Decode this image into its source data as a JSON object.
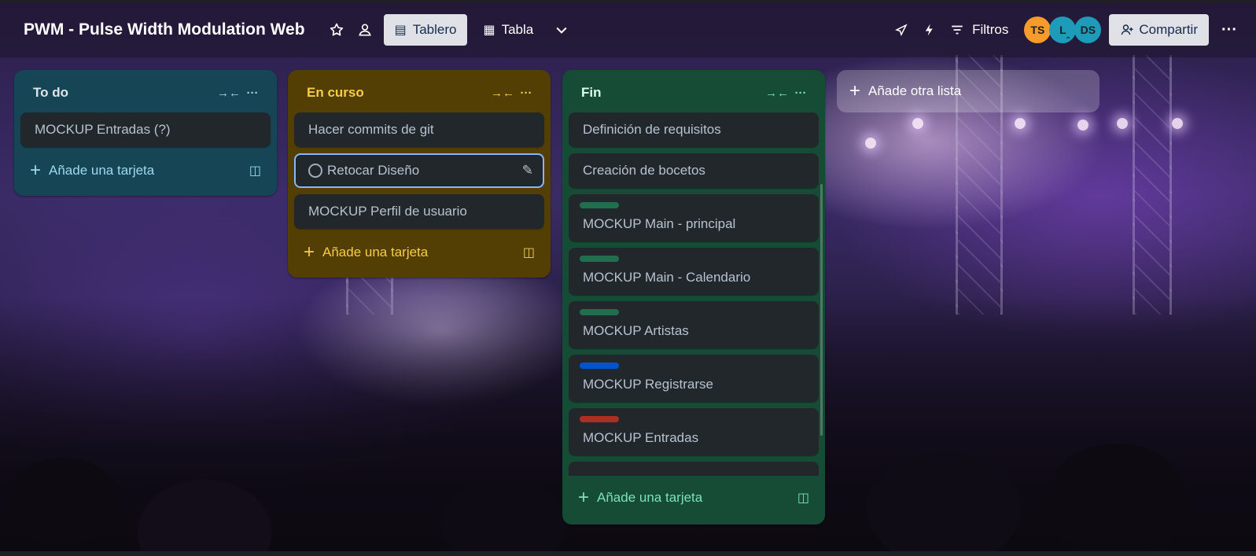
{
  "header": {
    "board_title": "PWM - Pulse Width Modulation Web",
    "views": [
      {
        "label": "Tablero",
        "active": true
      },
      {
        "label": "Tabla",
        "active": false
      }
    ],
    "filters_label": "Filtros",
    "share_label": "Compartir",
    "avatars": [
      {
        "initials": "TS",
        "color": "#f89b2a"
      },
      {
        "initials": "L",
        "color": "#1d9bb8"
      },
      {
        "initials": "DS",
        "color": "#1d9bb8"
      }
    ]
  },
  "lists": {
    "todo": {
      "title": "To do",
      "cards": [
        "MOCKUP Entradas (?)"
      ],
      "add_card": "Añade una tarjeta"
    },
    "en_curso": {
      "title": "En curso",
      "cards": [
        "Hacer commits de git",
        "Retocar Diseño",
        "MOCKUP Perfil de usuario"
      ],
      "add_card": "Añade una tarjeta"
    },
    "fin": {
      "title": "Fin",
      "cards": [
        {
          "title": "Definición de requisitos",
          "label_color": null
        },
        {
          "title": "Creación de bocetos",
          "label_color": null
        },
        {
          "title": "MOCKUP Main - principal",
          "label_color": "#216e4e"
        },
        {
          "title": "MOCKUP Main - Calendario",
          "label_color": "#216e4e"
        },
        {
          "title": "MOCKUP Artistas",
          "label_color": "#216e4e"
        },
        {
          "title": "MOCKUP Registrarse",
          "label_color": "#0055cc"
        },
        {
          "title": "MOCKUP Entradas",
          "label_color": "#ae2e24"
        }
      ],
      "add_card": "Añade una tarjeta"
    }
  },
  "add_list_label": "Añade otra lista"
}
